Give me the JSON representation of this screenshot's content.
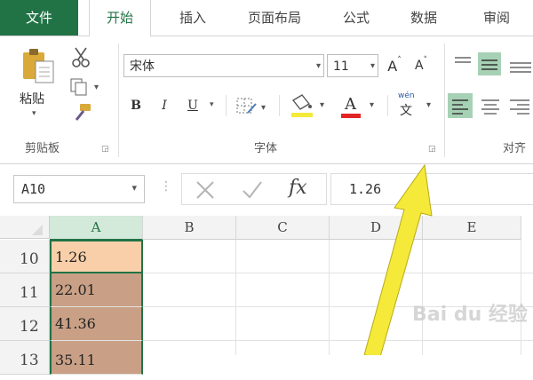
{
  "tabs": [
    "文件",
    "开始",
    "插入",
    "页面布局",
    "公式",
    "数据",
    "审阅"
  ],
  "clipboard": {
    "paste_label": "粘贴",
    "group_label": "剪贴板"
  },
  "font": {
    "name": "宋体",
    "size": "11",
    "grow_label": "A",
    "shrink_label": "A",
    "bold": "B",
    "italic": "I",
    "underline": "U",
    "font_color_letter": "A",
    "phonetic_top": "wén",
    "phonetic_bottom": "文",
    "group_label": "字体"
  },
  "alignment": {
    "group_label": "对齐"
  },
  "formula_bar": {
    "name_box": "A10",
    "fx_label": "fx",
    "value": "1.26"
  },
  "columns": [
    "A",
    "B",
    "C",
    "D",
    "E"
  ],
  "rows": [
    {
      "num": "10",
      "a": "1.26"
    },
    {
      "num": "11",
      "a": "22.01"
    },
    {
      "num": "12",
      "a": "41.36"
    },
    {
      "num": "13",
      "a": "35.11"
    }
  ],
  "watermark": "Bai du 经验",
  "colors": {
    "excel_green": "#217346",
    "selected_cell": "#f8cfa9",
    "highlight_cell": "#c9a086",
    "arrow": "#f5e93a",
    "font_color_bar": "#e32424"
  }
}
